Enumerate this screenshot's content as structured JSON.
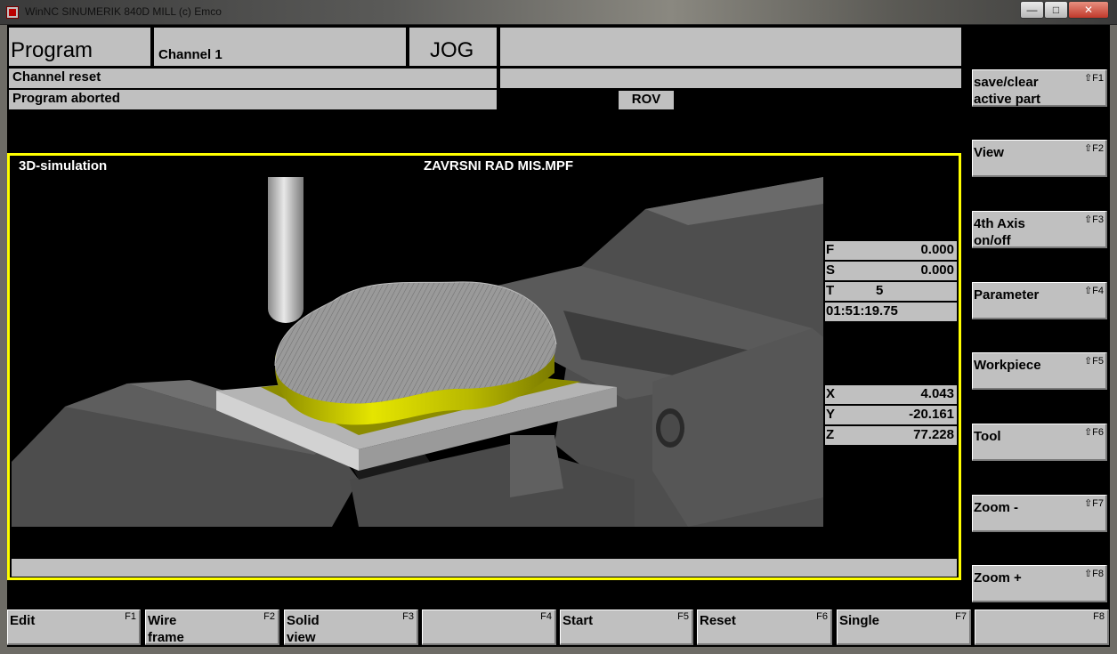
{
  "window": {
    "title": "WinNC SINUMERIK 840D MILL (c) Emco",
    "minimize_glyph": "—",
    "maximize_glyph": "□",
    "close_glyph": "✕"
  },
  "header": {
    "area": "Program",
    "channel": "Channel 1",
    "mode": "JOG",
    "status_line1": "Channel reset",
    "status_line2": "Program aborted",
    "rov": "ROV"
  },
  "simulation": {
    "title": "3D-simulation",
    "program": "ZAVRSNI RAD MIS.MPF",
    "feed": {
      "label": "F",
      "value": "0.000"
    },
    "spindle": {
      "label": "S",
      "value": "0.000"
    },
    "tool": {
      "label": "T",
      "value": "5"
    },
    "time": "01:51:19.75",
    "axes": [
      {
        "label": "X",
        "value": "4.043"
      },
      {
        "label": "Y",
        "value": "-20.161"
      },
      {
        "label": "Z",
        "value": "77.228"
      }
    ]
  },
  "vertical_softkeys": [
    {
      "label": "save/clear\nactive part",
      "key": "⇧F1"
    },
    {
      "label": "View",
      "key": "⇧F2"
    },
    {
      "label": "4th Axis\non/off",
      "key": "⇧F3"
    },
    {
      "label": "Parameter",
      "key": "⇧F4"
    },
    {
      "label": "Workpiece",
      "key": "⇧F5"
    },
    {
      "label": "Tool",
      "key": "⇧F6"
    },
    {
      "label": "Zoom -",
      "key": "⇧F7"
    },
    {
      "label": "Zoom +",
      "key": "⇧F8"
    }
  ],
  "horizontal_softkeys": [
    {
      "label": "Edit",
      "key": "F1"
    },
    {
      "label": "Wire\nframe",
      "key": "F2"
    },
    {
      "label": "Solid\nview",
      "key": "F3"
    },
    {
      "label": "",
      "key": "F4"
    },
    {
      "label": "Start",
      "key": "F5"
    },
    {
      "label": "Reset",
      "key": "F6"
    },
    {
      "label": "Single",
      "key": "F7"
    },
    {
      "label": "",
      "key": "F8"
    }
  ],
  "colors": {
    "panel": "#c0c0c0",
    "frame": "#ffff00",
    "workpiece": "#c8c800"
  }
}
